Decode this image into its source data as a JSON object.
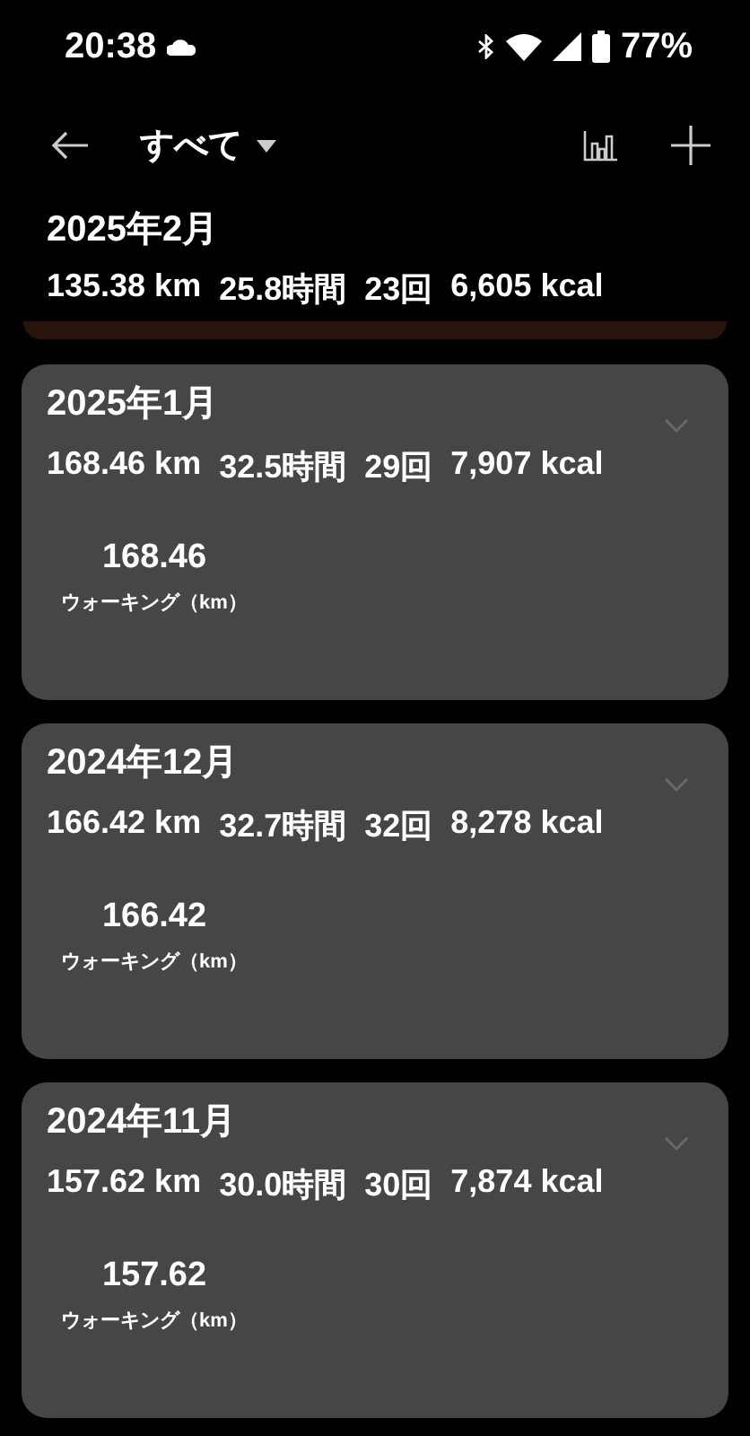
{
  "status_bar": {
    "time": "20:38",
    "battery": "77%"
  },
  "app_bar": {
    "title": "すべて"
  },
  "current": {
    "title": "2025年2月",
    "stats": [
      "135.38 km",
      "25.8時間",
      "23回",
      "6,605 kcal"
    ]
  },
  "months": [
    {
      "title": "2025年1月",
      "stats": [
        "168.46 km",
        "32.5時間",
        "29回",
        "7,907 kcal"
      ],
      "activities": [
        {
          "value": "168.46",
          "label": "ウォーキング（km）"
        }
      ]
    },
    {
      "title": "2024年12月",
      "stats": [
        "166.42 km",
        "32.7時間",
        "32回",
        "8,278 kcal"
      ],
      "activities": [
        {
          "value": "166.42",
          "label": "ウォーキング（km）"
        }
      ]
    },
    {
      "title": "2024年11月",
      "stats": [
        "157.62 km",
        "30.0時間",
        "30回",
        "7,874 kcal"
      ],
      "activities": [
        {
          "value": "157.62",
          "label": "ウォーキング（km）"
        }
      ]
    }
  ]
}
